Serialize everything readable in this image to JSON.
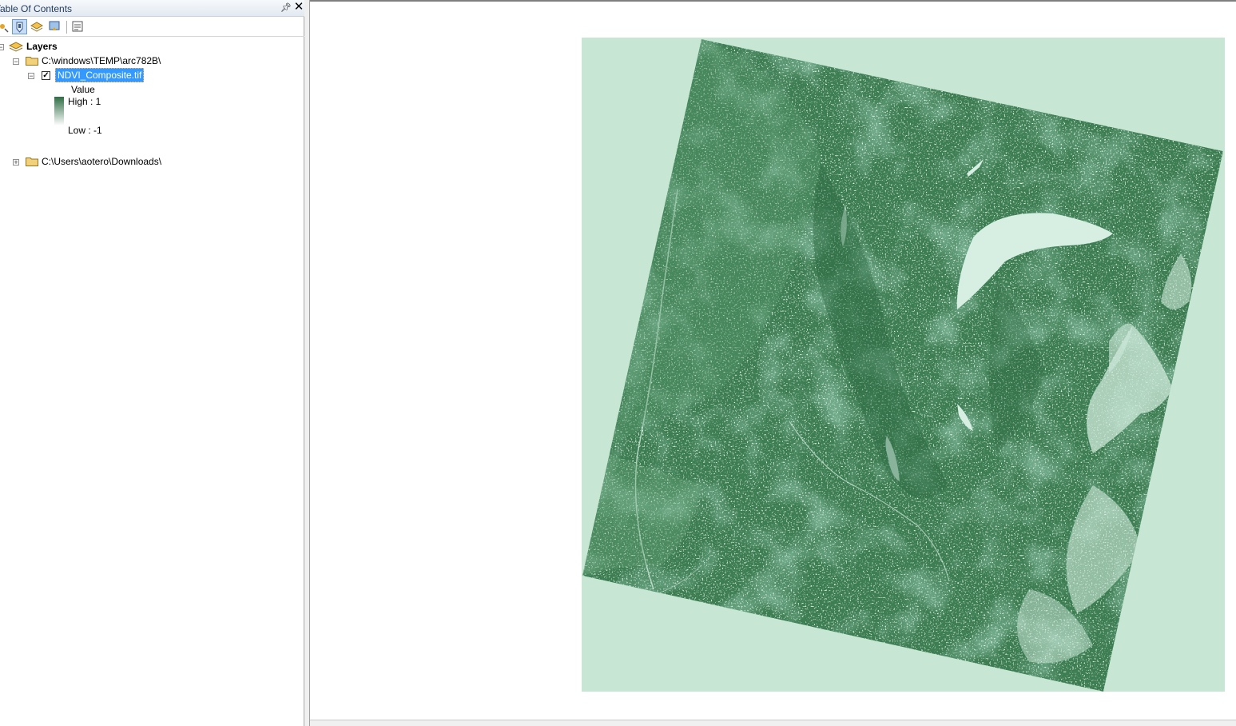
{
  "toc": {
    "title": "Table Of Contents",
    "toolbar": [
      {
        "icon": "list-by-drawing-order-icon"
      },
      {
        "icon": "list-by-source-icon",
        "active": true
      },
      {
        "icon": "list-by-visibility-icon"
      },
      {
        "icon": "list-by-selection-icon"
      },
      {
        "icon": "options-icon"
      }
    ],
    "tree": {
      "root_label": "Layers",
      "folder1": "C:\\windows\\TEMP\\arc782B\\",
      "layer_name": "NDVI_Composite.tif",
      "layer_checked": true,
      "legend": {
        "field": "Value",
        "high": "High : 1",
        "low": "Low : -1",
        "high_color": "#2e6e45",
        "low_color": "#ffffff"
      },
      "folder2": "C:\\Users\\aotero\\Downloads\\"
    }
  },
  "map": {
    "background_color": "#c8e6d4",
    "raster_color": "#3d7d52",
    "water_color": "#d6efe2"
  }
}
